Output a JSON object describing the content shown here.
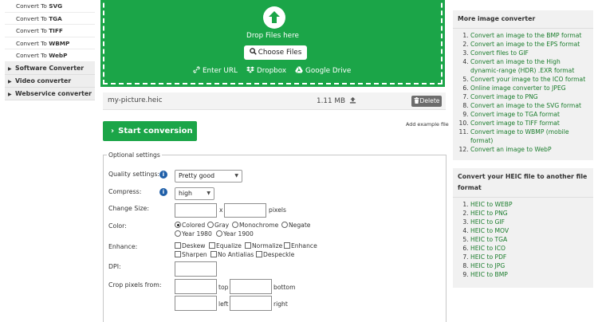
{
  "sidebar": {
    "subitems": [
      {
        "prefix": "Convert To ",
        "format": "SVG"
      },
      {
        "prefix": "Convert To ",
        "format": "TGA"
      },
      {
        "prefix": "Convert To ",
        "format": "TIFF"
      },
      {
        "prefix": "Convert To ",
        "format": "WBMP"
      },
      {
        "prefix": "Convert To ",
        "format": "WebP"
      }
    ],
    "categories": [
      {
        "label": "Software Converter"
      },
      {
        "label": "Video converter"
      },
      {
        "label": "Webservice converter"
      }
    ]
  },
  "upload": {
    "drop_text": "Drop Files here",
    "choose_label": "Choose Files",
    "sources": {
      "url": "Enter URL",
      "dropbox": "Dropbox",
      "gdrive": "Google Drive"
    },
    "colors": {
      "zone": "#1ba548"
    }
  },
  "file": {
    "name": "my-picture.heic",
    "size": "1.11 MB",
    "delete_label": "Delete"
  },
  "actions": {
    "start_label": "Start conversion",
    "add_example_label": "Add example file"
  },
  "settings": {
    "legend": "Optional settings",
    "quality": {
      "label": "Quality settings:",
      "value": "Pretty good"
    },
    "compress": {
      "label": "Compress:",
      "value": "high"
    },
    "change_size": {
      "label": "Change Size:",
      "separator": "x",
      "unit": "pixels"
    },
    "color": {
      "label": "Color:",
      "options": [
        "Colored",
        "Gray",
        "Monochrome",
        "Negate",
        "Year 1980",
        "Year 1900"
      ],
      "selected": "Colored"
    },
    "enhance": {
      "label": "Enhance:",
      "options": [
        "Deskew",
        "Equalize",
        "Normalize",
        "Enhance",
        "Sharpen",
        "No Antialias",
        "Despeckle"
      ]
    },
    "dpi": {
      "label": "DPI:"
    },
    "crop": {
      "label": "Crop pixels from:",
      "top": "top",
      "bottom": "bottom",
      "left": "left",
      "right": "right"
    }
  },
  "more_converters": {
    "title": "More image converter",
    "items": [
      "Convert an image to the BMP format",
      "Convert an image to the EPS format",
      "Convert files to GIF",
      "Convert an image to the High dynamic-range (HDR) .EXR format",
      "Convert your image to the ICO format",
      "Online image converter to JPEG",
      "Convert image to PNG",
      "Convert an image to the SVG format",
      "Convert image to TGA format",
      "Convert image to TIFF format",
      "Convert image to WBMP (mobile format)",
      "Convert an image to WebP"
    ]
  },
  "heic_converters": {
    "title": "Convert your HEIC file to another file format",
    "items": [
      "HEIC to WEBP",
      "HEIC to PNG",
      "HEIC to GIF",
      "HEIC to MOV",
      "HEIC to TGA",
      "HEIC to ICO",
      "HEIC to PDF",
      "HEIC to JPG",
      "HEIC to BMP"
    ]
  }
}
